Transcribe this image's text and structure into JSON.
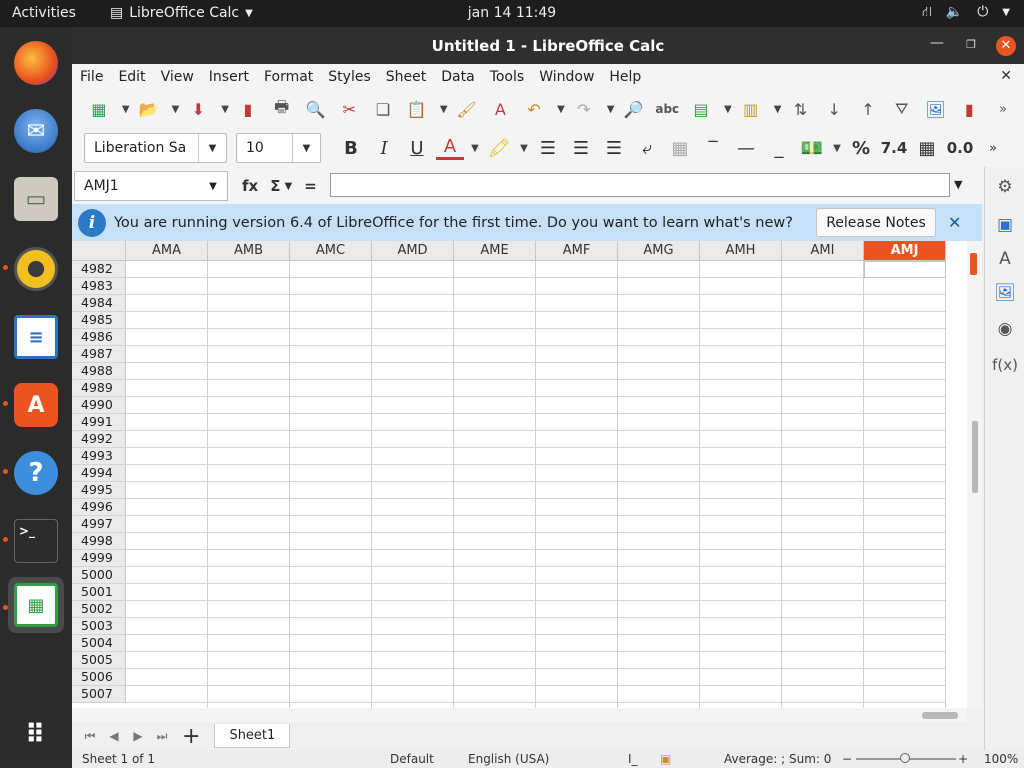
{
  "topbar": {
    "activities": "Activities",
    "app_name": "LibreOffice Calc",
    "clock": "jan 14  11:49"
  },
  "window": {
    "title": "Untitled 1 - LibreOffice Calc"
  },
  "menu": [
    "File",
    "Edit",
    "View",
    "Insert",
    "Format",
    "Styles",
    "Sheet",
    "Data",
    "Tools",
    "Window",
    "Help"
  ],
  "format_bar": {
    "font_name": "Liberation Sa",
    "font_size": "10",
    "percent": "%",
    "number_format": "7.4",
    "decimal": "0.0"
  },
  "formula_bar": {
    "cell_ref": "AMJ1",
    "formula": ""
  },
  "infobar": {
    "message": "You are running version 6.4 of LibreOffice for the first time. Do you want to learn what's new?",
    "button": "Release Notes"
  },
  "grid": {
    "columns": [
      "AMA",
      "AMB",
      "AMC",
      "AMD",
      "AME",
      "AMF",
      "AMG",
      "AMH",
      "AMI",
      "AMJ"
    ],
    "selected_column": "AMJ",
    "rows": [
      "4982",
      "4983",
      "4984",
      "4985",
      "4986",
      "4987",
      "4988",
      "4989",
      "4990",
      "4991",
      "4992",
      "4993",
      "4994",
      "4995",
      "4996",
      "4997",
      "4998",
      "4999",
      "5000",
      "5001",
      "5002",
      "5003",
      "5004",
      "5005",
      "5006",
      "5007"
    ]
  },
  "tabs": {
    "sheet": "Sheet1"
  },
  "status": {
    "sheet_info": "Sheet 1 of 1",
    "page_style": "Default",
    "language": "English (USA)",
    "summary": "Average: ; Sum: 0",
    "zoom": "100%"
  },
  "colors": {
    "accent": "#e95420",
    "info_bg": "#c6e0f5"
  }
}
